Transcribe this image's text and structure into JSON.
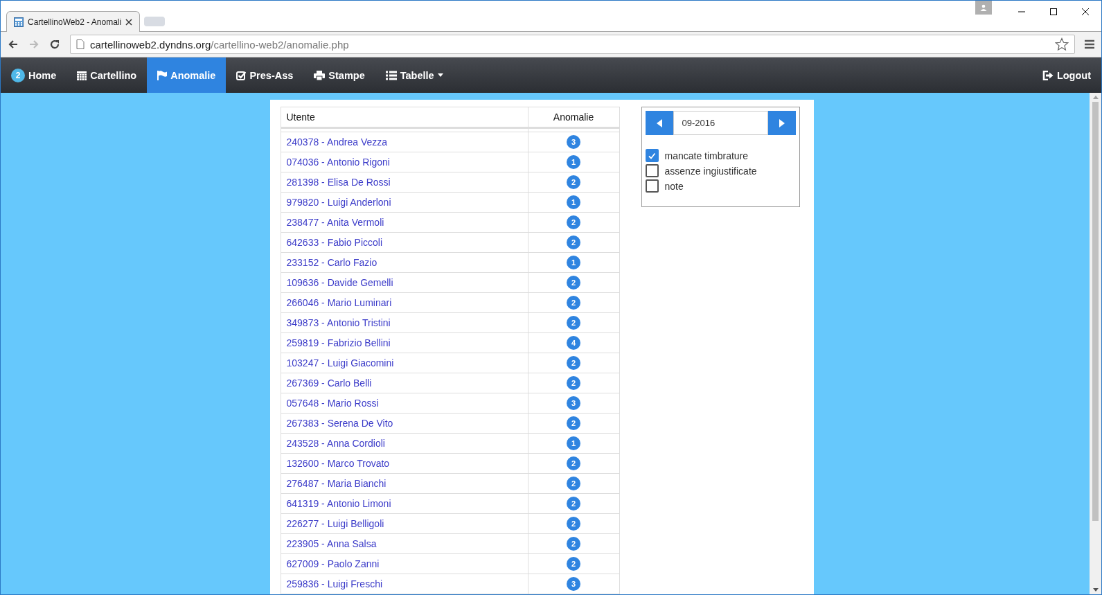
{
  "browser": {
    "tab_title": "CartellinoWeb2 - Anomali",
    "url_host": "cartellinoweb2.dyndns.org",
    "url_path": "/cartellino-web2/anomalie.php"
  },
  "navbar": {
    "items": [
      {
        "label": "Home",
        "badge": "2",
        "selected": false
      },
      {
        "label": "Cartellino",
        "selected": false
      },
      {
        "label": "Anomalie",
        "selected": true
      },
      {
        "label": "Pres-Ass",
        "selected": false
      },
      {
        "label": "Stampe",
        "selected": false
      },
      {
        "label": "Tabelle",
        "dropdown": true,
        "selected": false
      }
    ],
    "logout": "Logout"
  },
  "table": {
    "columns": [
      "Utente",
      "Anomalie"
    ],
    "rows": [
      {
        "user": "240378 - Andrea Vezza",
        "count": "3"
      },
      {
        "user": "074036 - Antonio Rigoni",
        "count": "1"
      },
      {
        "user": "281398 - Elisa De Rossi",
        "count": "2"
      },
      {
        "user": "979820 - Luigi Anderloni",
        "count": "1"
      },
      {
        "user": "238477 - Anita Vermoli",
        "count": "2"
      },
      {
        "user": "642633 - Fabio Piccoli",
        "count": "2"
      },
      {
        "user": "233152 - Carlo Fazio",
        "count": "1"
      },
      {
        "user": "109636 - Davide Gemelli",
        "count": "2"
      },
      {
        "user": "266046 - Mario Luminari",
        "count": "2"
      },
      {
        "user": "349873 - Antonio Tristini",
        "count": "2"
      },
      {
        "user": "259819 - Fabrizio Bellini",
        "count": "4"
      },
      {
        "user": "103247 - Luigi Giacomini",
        "count": "2"
      },
      {
        "user": "267369 - Carlo Belli",
        "count": "2"
      },
      {
        "user": "057648 - Mario Rossi",
        "count": "3"
      },
      {
        "user": "267383 - Serena De Vito",
        "count": "2"
      },
      {
        "user": "243528 - Anna Cordioli",
        "count": "1"
      },
      {
        "user": "132600 - Marco Trovato",
        "count": "2"
      },
      {
        "user": "276487 - Maria Bianchi",
        "count": "2"
      },
      {
        "user": "641319 - Antonio Limoni",
        "count": "2"
      },
      {
        "user": "226277 - Luigi Belligoli",
        "count": "2"
      },
      {
        "user": "223905 - Anna Salsa",
        "count": "2"
      },
      {
        "user": "627009 - Paolo Zanni",
        "count": "2"
      },
      {
        "user": "259836 - Luigi Freschi",
        "count": "3"
      }
    ]
  },
  "filters": {
    "month": "09-2016",
    "options": [
      {
        "label": "mancate timbrature",
        "checked": true
      },
      {
        "label": "assenze ingiustificate",
        "checked": false
      },
      {
        "label": "note",
        "checked": false
      }
    ]
  }
}
